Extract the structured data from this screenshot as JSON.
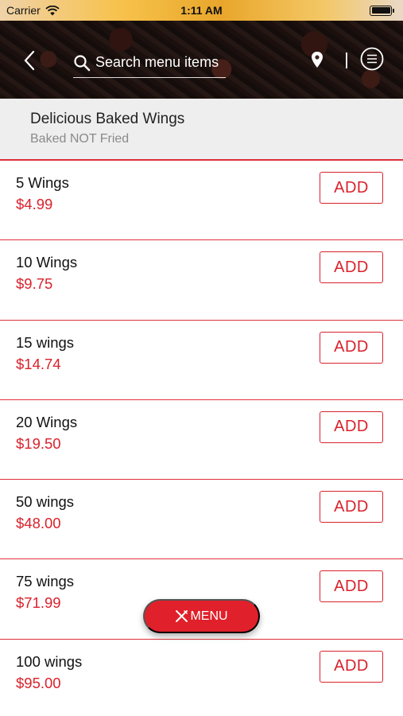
{
  "status_bar": {
    "carrier": "Carrier",
    "time": "1:11 AM",
    "icons": [
      "wifi-icon",
      "battery-icon"
    ]
  },
  "nav": {
    "search_placeholder": "Search menu items",
    "icons": [
      "back-chevron-icon",
      "search-icon",
      "location-pin-icon",
      "menu-list-icon"
    ]
  },
  "category": {
    "title": "Delicious Baked Wings",
    "subtitle": "Baked NOT Fried"
  },
  "items": [
    {
      "name": "5 Wings",
      "price": "$4.99",
      "add_label": "ADD"
    },
    {
      "name": "10 Wings",
      "price": "$9.75",
      "add_label": "ADD"
    },
    {
      "name": "15 wings",
      "price": "$14.74",
      "add_label": "ADD"
    },
    {
      "name": "20 Wings",
      "price": "$19.50",
      "add_label": "ADD"
    },
    {
      "name": "50 wings",
      "price": "$48.00",
      "add_label": "ADD"
    },
    {
      "name": "75 wings",
      "price": "$71.99",
      "add_label": "ADD"
    },
    {
      "name": "100 wings",
      "price": "$95.00",
      "add_label": "ADD"
    }
  ],
  "fab": {
    "label": "MENU",
    "icon": "cutlery-icon"
  },
  "colors": {
    "accent": "#d9222c",
    "fab": "#e0202a",
    "category_bg": "#eeeeee"
  }
}
